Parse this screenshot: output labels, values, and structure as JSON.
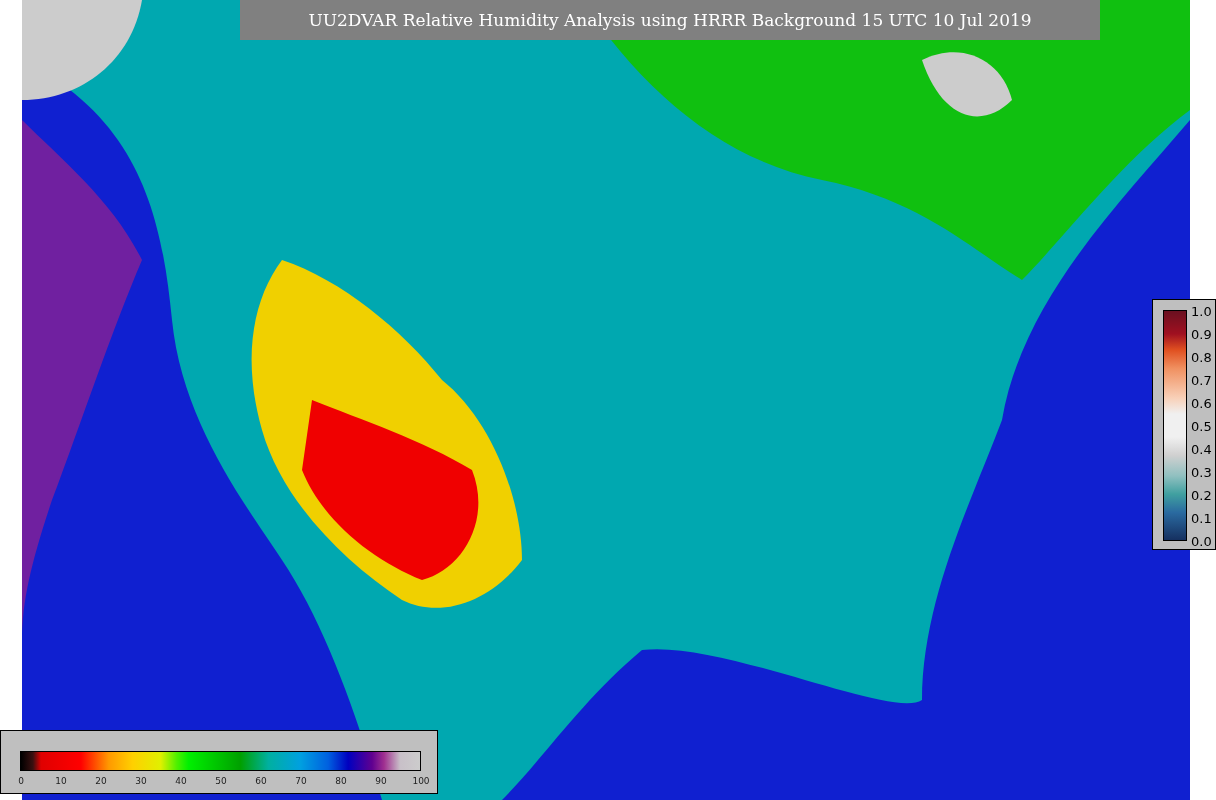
{
  "title": "UU2DVAR Relative Humidity Analysis using HRRR Background 15 UTC 10 Jul 2019",
  "humidity_colorbar": {
    "ticks": [
      "0",
      "10",
      "20",
      "30",
      "40",
      "50",
      "60",
      "70",
      "80",
      "90",
      "100"
    ]
  },
  "ratio_colorbar": {
    "ticks": [
      "1.0",
      "0.9",
      "0.8",
      "0.7",
      "0.6",
      "0.5",
      "0.4",
      "0.3",
      "0.2",
      "0.1",
      "0.0"
    ]
  }
}
